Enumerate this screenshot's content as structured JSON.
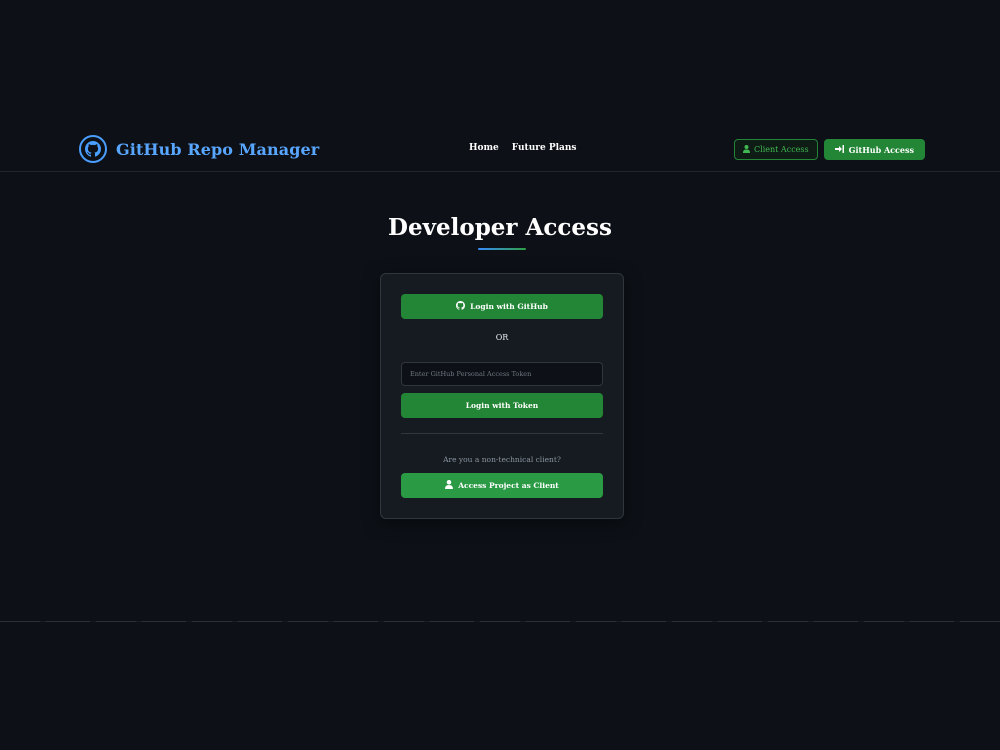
{
  "header": {
    "brand_title": "GitHub Repo Manager",
    "brand_icon": "github-icon",
    "nav": [
      {
        "label": "Home"
      },
      {
        "label": "Future Plans"
      }
    ],
    "client_access_label": "Client Access",
    "client_access_icon": "user-icon",
    "github_access_label": "GitHub Access",
    "github_access_icon": "sign-in-icon"
  },
  "main": {
    "title": "Developer Access"
  },
  "card": {
    "github_login_label": "Login with GitHub",
    "or_text": "OR",
    "token_placeholder": "Enter GitHub Personal Access Token",
    "token_value": "",
    "token_login_label": "Login with Token",
    "client_question": "Are you a non-technical client?",
    "client_button_label": "Access Project as Client"
  },
  "colors": {
    "background": "#0d1117",
    "card": "#161b22",
    "accent_green": "#238636",
    "accent_blue": "#58a6ff"
  }
}
